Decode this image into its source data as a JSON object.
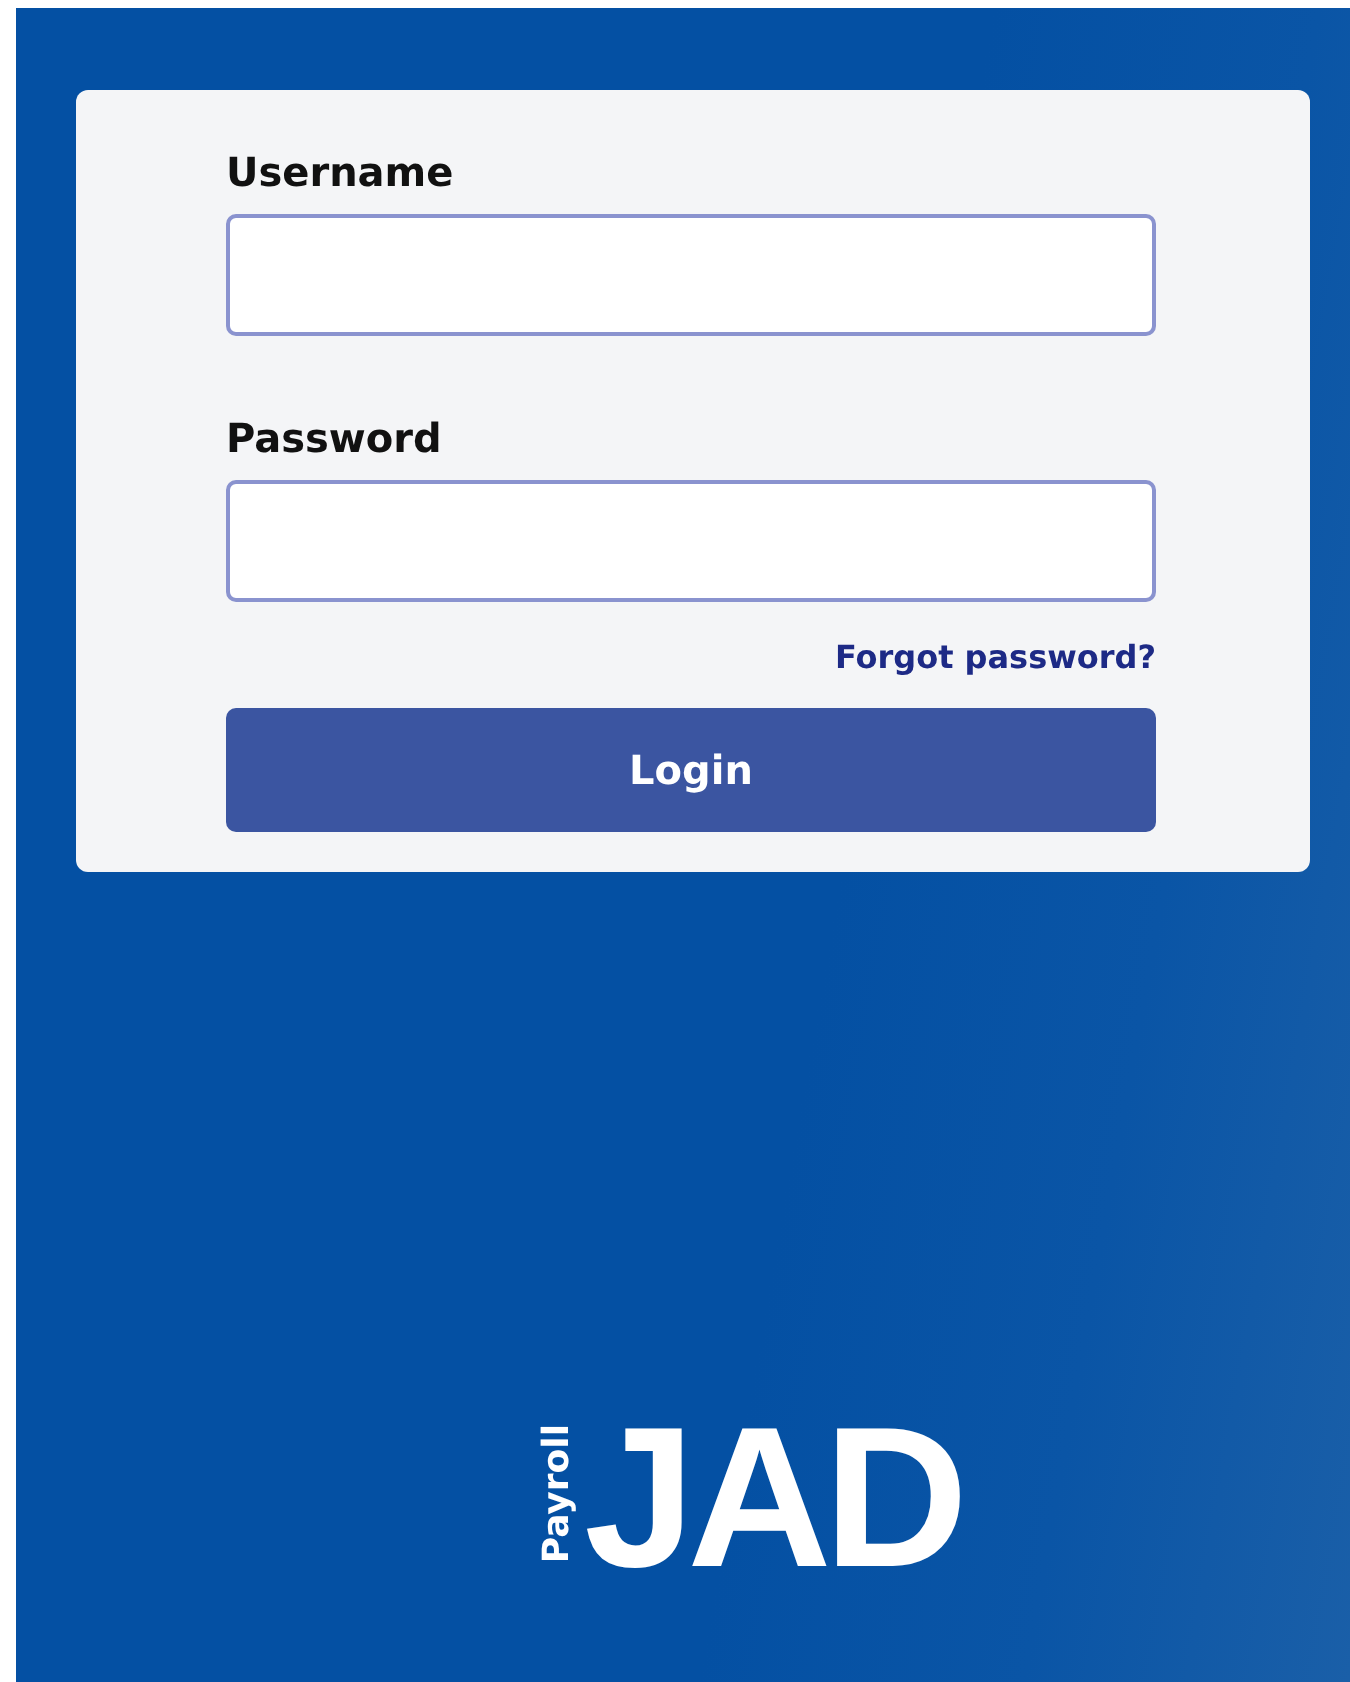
{
  "login_form": {
    "fields": [
      {
        "label": "Username"
      },
      {
        "label": "Password"
      }
    ],
    "forgot_link": "Forgot password?",
    "submit_button": "Login"
  },
  "logo": {
    "tagline": "Payroll",
    "wordmark": "JAD"
  }
}
